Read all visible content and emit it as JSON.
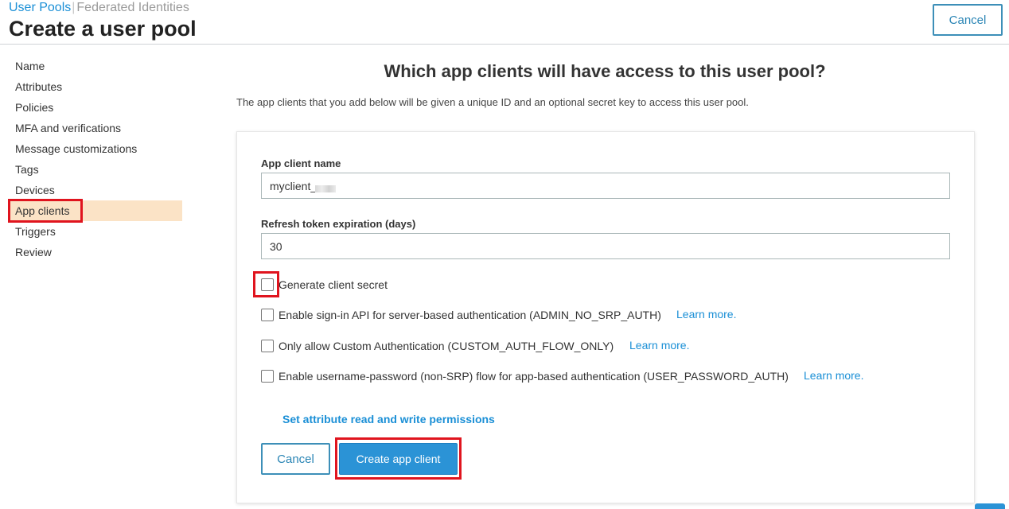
{
  "header": {
    "breadcrumb_active": "User Pools",
    "breadcrumb_separator": "|",
    "breadcrumb_inactive": "Federated Identities",
    "title": "Create a user pool",
    "cancel_label": "Cancel"
  },
  "sidebar": {
    "items": [
      {
        "label": "Name"
      },
      {
        "label": "Attributes"
      },
      {
        "label": "Policies"
      },
      {
        "label": "MFA and verifications"
      },
      {
        "label": "Message customizations"
      },
      {
        "label": "Tags"
      },
      {
        "label": "Devices"
      },
      {
        "label": "App clients"
      },
      {
        "label": "Triggers"
      },
      {
        "label": "Review"
      }
    ],
    "active_item": "App clients"
  },
  "main": {
    "title": "Which app clients will have access to this user pool?",
    "description": "The app clients that you add below will be given a unique ID and an optional secret key to access this user pool.",
    "form": {
      "client_name_label": "App client name",
      "client_name_value": "myclient_",
      "refresh_label": "Refresh token expiration (days)",
      "refresh_value": "30",
      "checkboxes": [
        {
          "label": "Generate client secret",
          "checked": false
        },
        {
          "label": "Enable sign-in API for server-based authentication (ADMIN_NO_SRP_AUTH)",
          "checked": false,
          "link": "Learn more."
        },
        {
          "label": "Only allow Custom Authentication (CUSTOM_AUTH_FLOW_ONLY)",
          "checked": false,
          "link": "Learn more."
        },
        {
          "label": "Enable username-password (non-SRP) flow for app-based authentication (USER_PASSWORD_AUTH)",
          "checked": false,
          "link": "Learn more."
        }
      ],
      "permissions_link": "Set attribute read and write permissions",
      "cancel_label": "Cancel",
      "create_label": "Create app client"
    }
  },
  "colors": {
    "accent": "#1a8fd6",
    "primary_button": "#2b93d6",
    "active_nav_bg": "#fbe3c6",
    "highlight": "#e0141e"
  }
}
